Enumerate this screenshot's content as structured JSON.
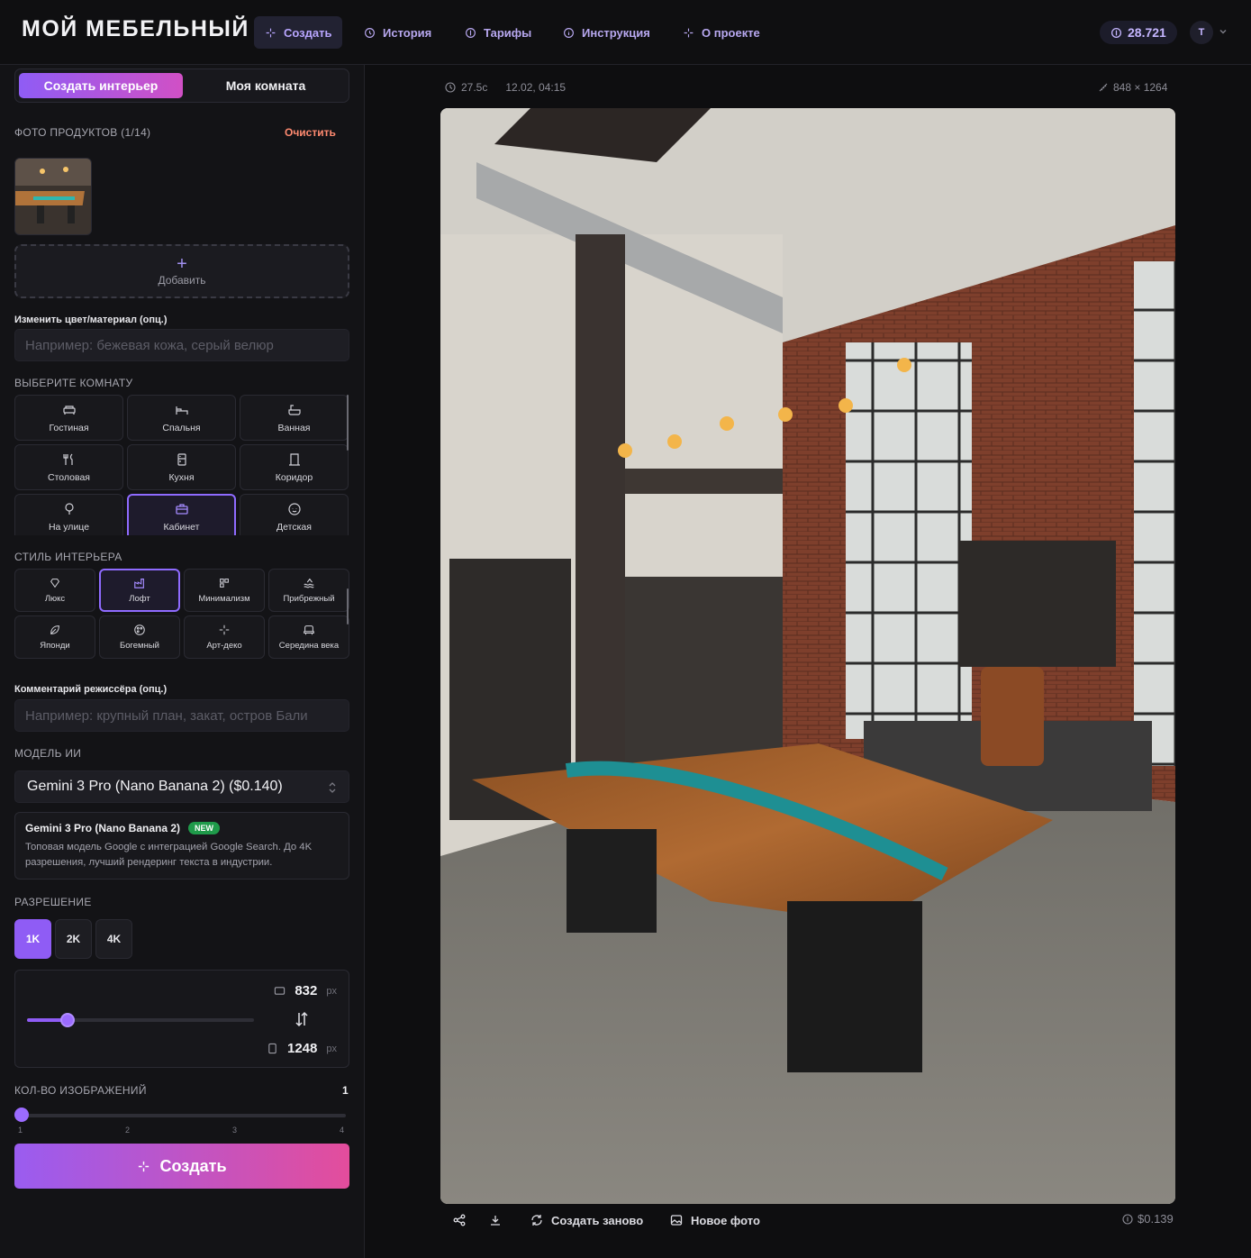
{
  "app": {
    "logo": "МОЙ МЕБЕЛЬНЫЙ"
  },
  "nav": {
    "items": [
      {
        "label": "Создать",
        "icon": "sparkles-icon",
        "active": true
      },
      {
        "label": "История",
        "icon": "history-icon"
      },
      {
        "label": "Тарифы",
        "icon": "coin-icon"
      },
      {
        "label": "Инструкция",
        "icon": "info-icon"
      },
      {
        "label": "О проекте",
        "icon": "sparkles-icon"
      }
    ],
    "balance": "28.721",
    "avatar": "T"
  },
  "sidebar": {
    "tabs": [
      "Создать интерьер",
      "Моя комната"
    ],
    "photos_label": "ФОТО ПРОДУКТОВ (1/14)",
    "clear_label": "Очистить",
    "add_label": "Добавить",
    "color_label": "Изменить цвет/материал (опц.)",
    "color_placeholder": "Например: бежевая кожа, серый велюр",
    "room_label": "ВЫБЕРИТЕ КОМНАТУ",
    "rooms": [
      {
        "label": "Гостиная",
        "icon": "sofa-icon"
      },
      {
        "label": "Спальня",
        "icon": "bed-icon"
      },
      {
        "label": "Ванная",
        "icon": "bath-icon"
      },
      {
        "label": "Столовая",
        "icon": "utensils-icon"
      },
      {
        "label": "Кухня",
        "icon": "fridge-icon"
      },
      {
        "label": "Коридор",
        "icon": "door-icon"
      },
      {
        "label": "На улице",
        "icon": "tree-icon"
      },
      {
        "label": "Кабинет",
        "icon": "briefcase-icon",
        "selected": true
      },
      {
        "label": "Детская",
        "icon": "baby-icon"
      }
    ],
    "style_label": "СТИЛЬ ИНТЕРЬЕРА",
    "styles": [
      {
        "label": "Люкс",
        "icon": "gem-icon"
      },
      {
        "label": "Лофт",
        "icon": "factory-icon",
        "selected": true
      },
      {
        "label": "Минимализм",
        "icon": "square-icon"
      },
      {
        "label": "Прибрежный",
        "icon": "waves-icon"
      },
      {
        "label": "Японди",
        "icon": "leaf-icon"
      },
      {
        "label": "Богемный",
        "icon": "palette-icon"
      },
      {
        "label": "Арт-деко",
        "icon": "sparkles-icon"
      },
      {
        "label": "Середина века",
        "icon": "armchair-icon"
      }
    ],
    "comment_label": "Комментарий режиссёра (опц.)",
    "comment_placeholder": "Например: крупный план, закат, остров Бали",
    "model_label": "МОДЕЛЬ ИИ",
    "model_selected": "Gemini 3 Pro (Nano Banana 2) ($0.140)",
    "model_card_title": "Gemini 3 Pro (Nano Banana 2)",
    "model_card_badge": "NEW",
    "model_card_desc": "Топовая модель Google с интеграцией Google Search. До 4K разрешения, лучший рендеринг текста в индустрии.",
    "resolution_label": "РАЗРЕШЕНИЕ",
    "resolutions": [
      "1K",
      "2K",
      "4K"
    ],
    "resolution_selected": "1K",
    "width": "832",
    "height": "1248",
    "px_unit": "px",
    "aspect_fraction": 0.18,
    "count_label": "КОЛ-ВО ИЗОБРАЖЕНИЙ",
    "count_value": "1",
    "count_ticks": [
      "1",
      "2",
      "3",
      "4"
    ],
    "create_label": "Создать"
  },
  "result": {
    "time": "27.5с",
    "date": "12.02, 04:15",
    "size": "848 × 1264",
    "actions": {
      "regenerate": "Создать заново",
      "new_photo": "Новое фото"
    },
    "cost": "$0.139"
  }
}
